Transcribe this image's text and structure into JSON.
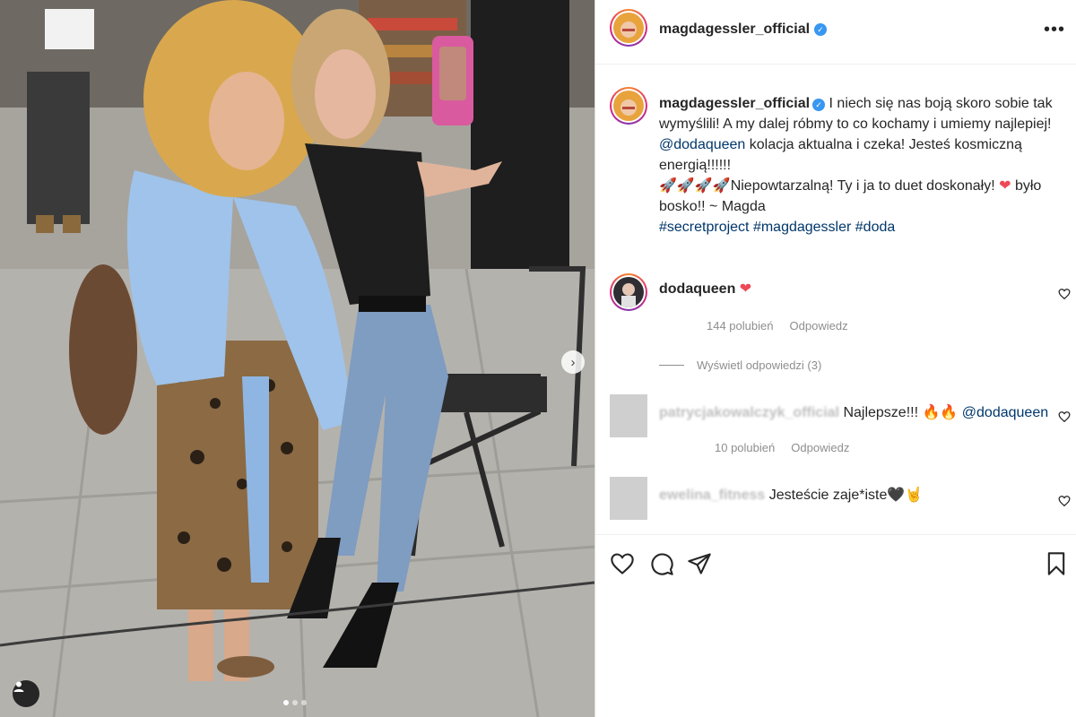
{
  "post": {
    "username": "magdagessler_official",
    "more_label": "•••",
    "verified_icon": "verified-badge-icon"
  },
  "caption": {
    "username": "magdagessler_official",
    "line1": "I niech się nas boją skoro sobie tak wymyślili! A my dalej róbmy to co kochamy i umiemy najlepiej!",
    "mention": "@dodaqueen",
    "line2": " kolacja aktualna i czeka! Jesteś kosmiczną energią!!!!!!",
    "rockets": "🚀🚀🚀🚀",
    "line3": "Niepowtarzalną! Ty i ja to duet doskonały!",
    "heart": "❤",
    "line4": " było bosko!! ~ Magda",
    "hashtags": "#secretproject #magdagessler #doda"
  },
  "comments": [
    {
      "username": "dodaqueen",
      "text": "❤",
      "likes": "144 polubień",
      "reply": "Odpowiedz",
      "view_replies": "Wyświetl odpowiedzi (3)"
    },
    {
      "username": "patrycjakowalczyk_official",
      "text": "Najlepsze!!! 🔥🔥",
      "mention": "@dodaqueen",
      "likes": "10 polubień",
      "reply": "Odpowiedz"
    },
    {
      "username": "ewelina_fitness",
      "text": "Jesteście zaje*iste🖤🤘"
    }
  ],
  "colors": {
    "link": "#00376b",
    "meta": "#8e8e8e",
    "heart_red": "#ed4956",
    "verified_blue": "#3897f0"
  },
  "carousel": {
    "dot_count": 3,
    "active_index": 0,
    "next_icon": "chevron-right-icon"
  }
}
